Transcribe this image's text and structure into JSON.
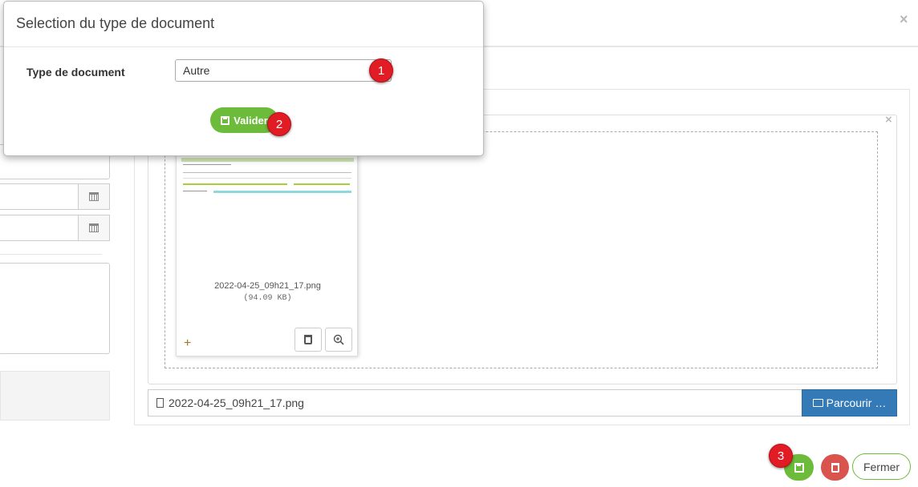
{
  "dialog": {
    "title": "Selection du type de document",
    "type_label": "Type de document",
    "type_value": "Autre",
    "validate_label": "Valider"
  },
  "badges": [
    "1",
    "2",
    "3"
  ],
  "background": {
    "close_glyph": "×",
    "preview_close_glyph": "×"
  },
  "thumbnail": {
    "file_name": "2022-04-25_09h21_17.png",
    "file_size": "(94.09 KB)",
    "add_glyph": "+"
  },
  "file_input": {
    "value": "2022-04-25_09h21_17.png",
    "browse_label": "Parcourir …"
  },
  "footer": {
    "close_label": "Fermer"
  },
  "colors": {
    "green": "#6dbb3b",
    "red": "#d9534f",
    "blue": "#337ab7",
    "badge_red": "#e11c24"
  }
}
